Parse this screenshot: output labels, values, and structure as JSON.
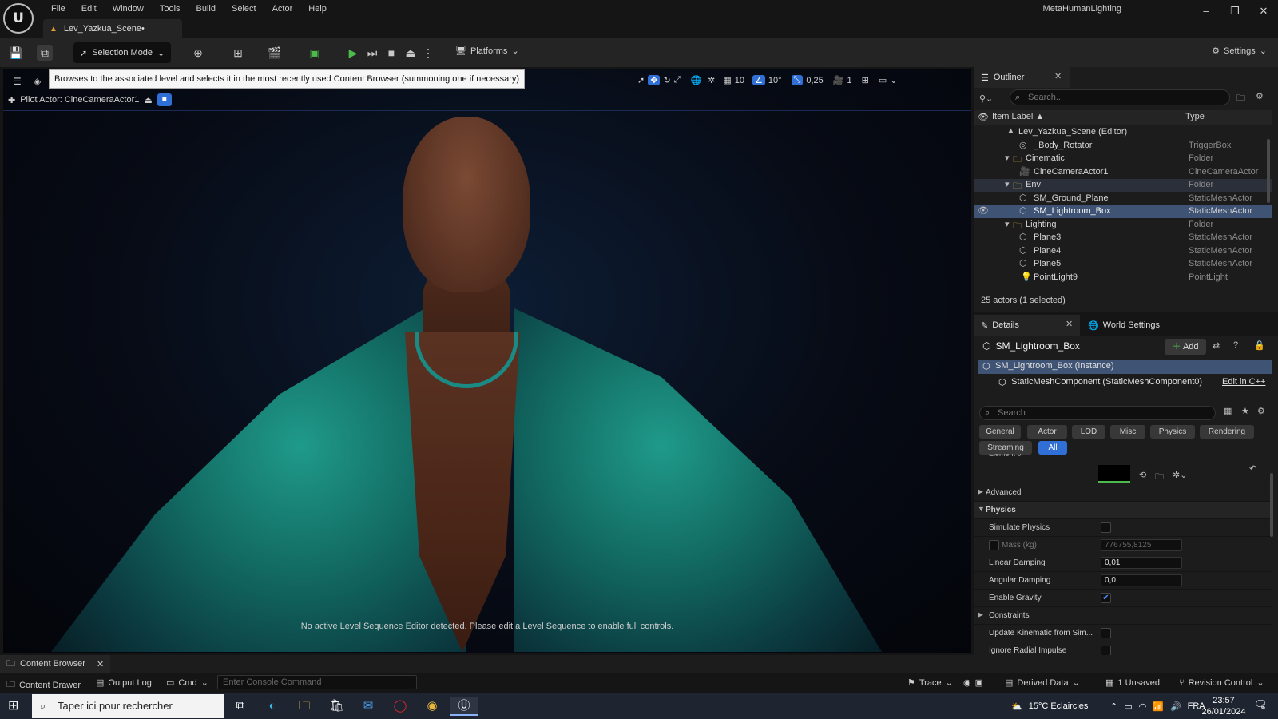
{
  "menu": [
    "File",
    "Edit",
    "Window",
    "Tools",
    "Build",
    "Select",
    "Actor",
    "Help"
  ],
  "doc_tab": "Lev_Yazkua_Scene•",
  "app_title": "MetaHumanLighting",
  "window_controls": [
    "–",
    "❐",
    "✕"
  ],
  "toolbar": {
    "mode_label": "Selection Mode",
    "platforms_label": "Platforms",
    "settings_label": "Settings"
  },
  "viewport": {
    "tooltip": "Browses to the associated level and selects it in the most recently used Content Browser (summoning one if necessary)",
    "pilot_label": "Pilot Actor: CineCameraActor1",
    "grid_snap": "10",
    "rot_snap": "10°",
    "scale_snap": "0,25",
    "camera_speed": "1",
    "message": "No active Level Sequence Editor detected. Please edit a Level Sequence to enable full controls."
  },
  "outliner": {
    "tab": "Outliner",
    "search_placeholder": "Search...",
    "col_label": "Item Label ▲",
    "col_type": "Type",
    "rows": [
      {
        "label": "Lev_Yazkua_Scene (Editor)",
        "type": ""
      },
      {
        "label": "_Body_Rotator",
        "type": "TriggerBox"
      },
      {
        "label": "Cinematic",
        "type": "Folder"
      },
      {
        "label": "CineCameraActor1",
        "type": "CineCameraActor"
      },
      {
        "label": "Env",
        "type": "Folder"
      },
      {
        "label": "SM_Ground_Plane",
        "type": "StaticMeshActor"
      },
      {
        "label": "SM_Lightroom_Box",
        "type": "StaticMeshActor"
      },
      {
        "label": "Lighting",
        "type": "Folder"
      },
      {
        "label": "Plane3",
        "type": "StaticMeshActor"
      },
      {
        "label": "Plane4",
        "type": "StaticMeshActor"
      },
      {
        "label": "Plane5",
        "type": "StaticMeshActor"
      },
      {
        "label": "PointLight9",
        "type": "PointLight"
      }
    ],
    "footer": "25 actors (1 selected)"
  },
  "details": {
    "tab": "Details",
    "world_tab": "World Settings",
    "actor_name": "SM_Lightroom_Box",
    "add_label": "Add",
    "instance_label": "SM_Lightroom_Box (Instance)",
    "component_label": "StaticMeshComponent (StaticMeshComponent0)",
    "edit_cpp": "Edit in C++",
    "search_placeholder": "Search",
    "categories": [
      "General",
      "Actor",
      "LOD",
      "Misc",
      "Physics",
      "Rendering",
      "Streaming",
      "All"
    ],
    "partial_label": "Element 0",
    "props": {
      "advanced": "Advanced",
      "physics": "Physics",
      "simulate_physics": "Simulate Physics",
      "mass": "Mass (kg)",
      "mass_value": "776755,8125",
      "linear_damping": "Linear Damping",
      "linear_damping_value": "0,01",
      "angular_damping": "Angular Damping",
      "angular_damping_value": "0,0",
      "enable_gravity": "Enable Gravity",
      "constraints": "Constraints",
      "update_kinematic": "Update Kinematic from Sim...",
      "ignore_radial": "Ignore Radial Impulse"
    }
  },
  "bottom": {
    "content_browser_tab": "Content Browser",
    "content_drawer": "Content Drawer",
    "output_log": "Output Log",
    "cmd": "Cmd",
    "console_placeholder": "Enter Console Command",
    "trace": "Trace",
    "derived_data": "Derived Data",
    "unsaved": "1 Unsaved",
    "revision_control": "Revision Control"
  },
  "taskbar": {
    "search_placeholder": "Taper ici pour rechercher",
    "weather": "15°C  Eclaircies",
    "lang": "FRA",
    "time": "23:57",
    "date": "26/01/2024",
    "notif_count": "6"
  }
}
